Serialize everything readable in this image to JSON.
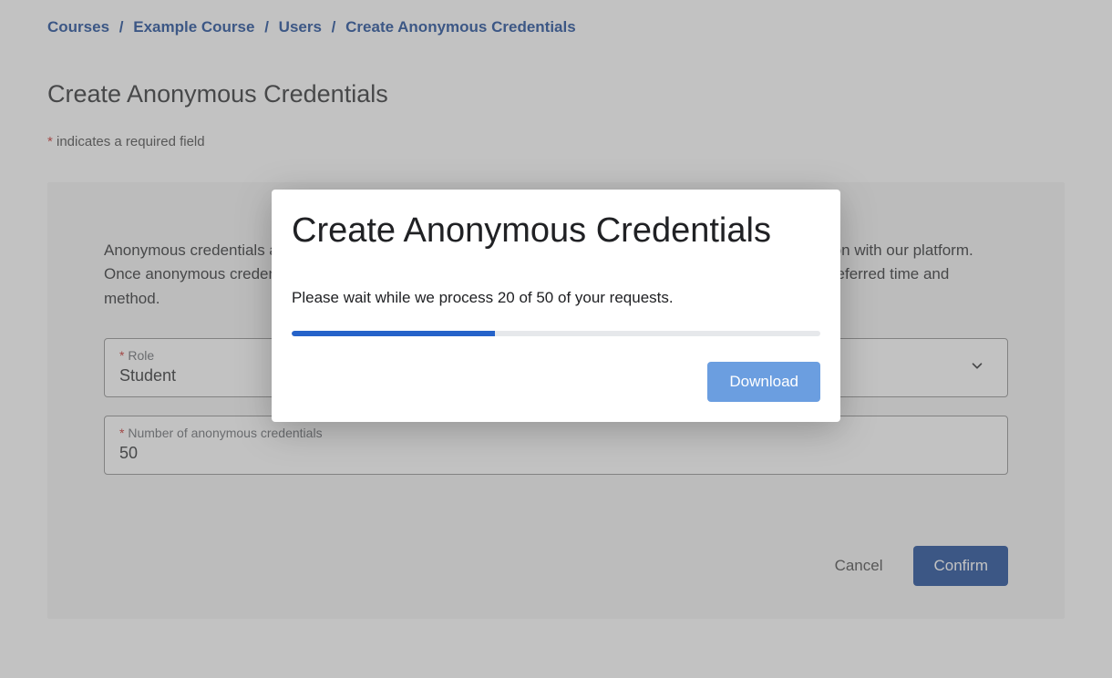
{
  "breadcrumb": {
    "items": [
      "Courses",
      "Example Course",
      "Users",
      "Create Anonymous Credentials"
    ],
    "separator": "/"
  },
  "page": {
    "title": "Create Anonymous Credentials",
    "required_note_prefix": "*",
    "required_note_text": " indicates a required field"
  },
  "form": {
    "description": "Anonymous credentials allow your Students or TAs to use our platform without sharing identifying information with our platform. Once anonymous credentials have been created, you may share them with your Students or TAs at your preferred time and method.",
    "role": {
      "label": "Role",
      "value": "Student"
    },
    "count": {
      "label": "Number of anonymous credentials",
      "value": "50"
    },
    "cancel_label": "Cancel",
    "confirm_label": "Confirm"
  },
  "modal": {
    "title": "Create Anonymous Credentials",
    "message": "Please wait while we process 20 of 50 of your requests.",
    "progress_percent": 38.5,
    "download_label": "Download"
  }
}
